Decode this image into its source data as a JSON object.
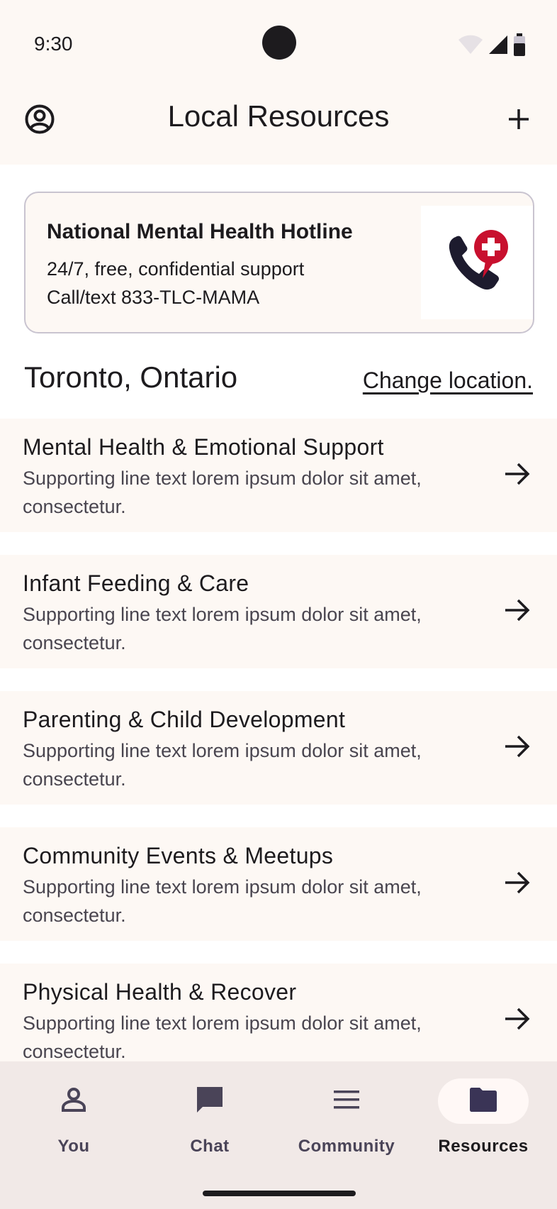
{
  "status_bar": {
    "time": "9:30"
  },
  "top_bar": {
    "title": "Local Resources"
  },
  "hotline": {
    "title": "National Mental Health Hotline",
    "line1": "24/7, free, confidential support",
    "line2": "Call/text 833-TLC-MAMA"
  },
  "location": {
    "name": "Toronto, Ontario",
    "change_label": "Change location."
  },
  "list": {
    "items": [
      {
        "title": "Mental Health & Emotional Support",
        "support": "Supporting line text lorem ipsum dolor sit amet, consectetur."
      },
      {
        "title": "Infant Feeding & Care",
        "support": "Supporting line text lorem ipsum dolor sit amet, consectetur."
      },
      {
        "title": "Parenting & Child Development",
        "support": "Supporting line text lorem ipsum dolor sit amet, consectetur."
      },
      {
        "title": "Community Events & Meetups",
        "support": "Supporting line text lorem ipsum dolor sit amet, consectetur."
      },
      {
        "title": "Physical Health & Recover",
        "support": "Supporting line text lorem ipsum dolor sit amet, consectetur."
      }
    ]
  },
  "bottom_nav": {
    "items": [
      {
        "label": "You",
        "icon": "person-icon"
      },
      {
        "label": "Chat",
        "icon": "chat-icon"
      },
      {
        "label": "Community",
        "icon": "menu-icon"
      },
      {
        "label": "Resources",
        "icon": "folder-icon",
        "active": true
      }
    ]
  },
  "colors": {
    "surface": "#fdf8f4",
    "nav_background": "#f1e9e7",
    "accent_red": "#c8102e",
    "text": "#1d1b1e"
  }
}
